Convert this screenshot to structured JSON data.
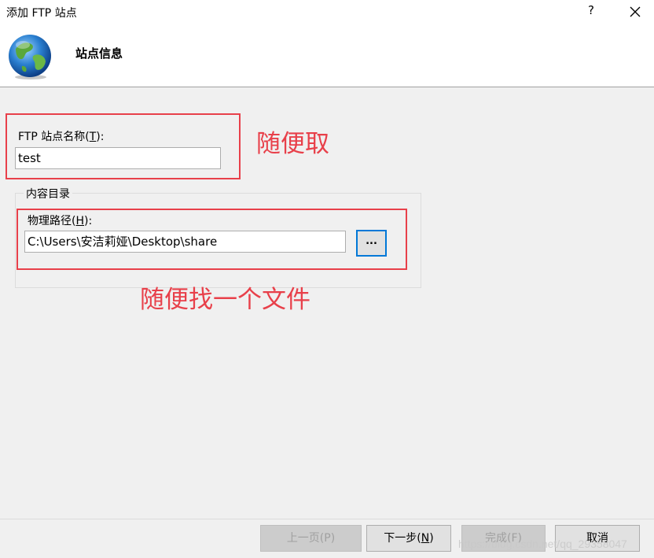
{
  "window": {
    "title": "添加 FTP 站点",
    "help": "?"
  },
  "header": {
    "heading": "站点信息"
  },
  "site_name": {
    "label": "FTP 站点名称(",
    "accel": "T",
    "label_end": "):",
    "value": "test"
  },
  "content_dir": {
    "group_title": "内容目录",
    "path_label": "物理路径(",
    "path_accel": "H",
    "path_label_end": "):",
    "path_value": "C:\\Users\\安洁莉娅\\Desktop\\share",
    "browse_label": "..."
  },
  "annotations": {
    "note1": "随便取",
    "note2": "随便找一个文件",
    "color": "#e8404a"
  },
  "buttons": {
    "prev": "上一页(P)",
    "next_pre": "下一步(",
    "next_accel": "N",
    "next_post": ")",
    "finish": "完成(F)",
    "cancel": "取消"
  },
  "watermark": "https://blog.csdn.net/qq_29358047"
}
